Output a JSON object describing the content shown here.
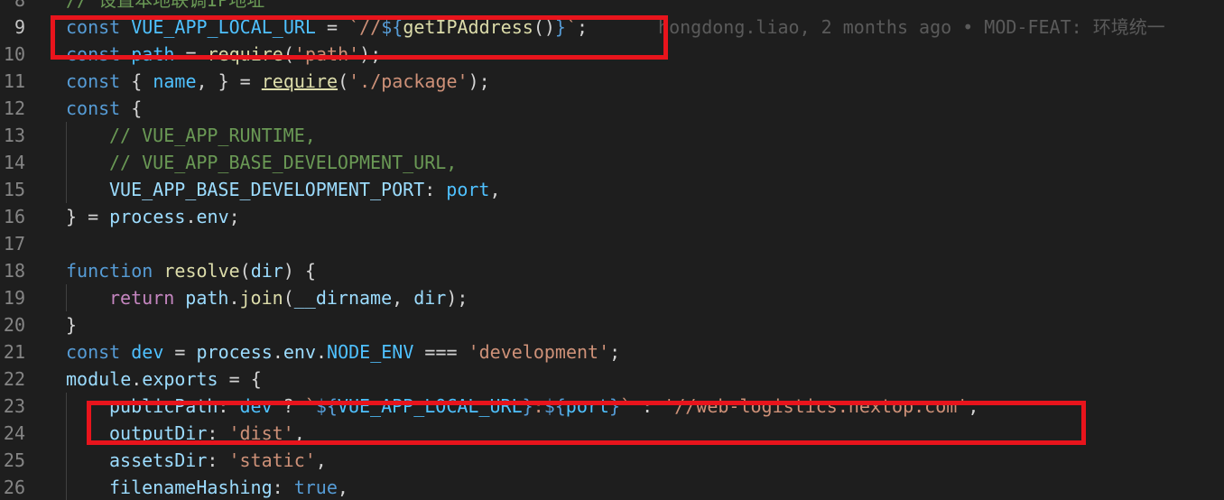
{
  "editor": {
    "accent_box_color": "#e8141c",
    "lines": [
      {
        "num": "8",
        "indent": 0,
        "tokens": [
          [
            "cmt",
            "// 设置本地联调IP地址"
          ]
        ]
      },
      {
        "num": "9",
        "indent": 0,
        "active": true,
        "tokens": [
          [
            "kw",
            "const"
          ],
          [
            "pun",
            " "
          ],
          [
            "cst",
            "VUE_APP_LOCAL_URL"
          ],
          [
            "pun",
            " = "
          ],
          [
            "str",
            "`//"
          ],
          [
            "tpl",
            "${"
          ],
          [
            "fn",
            "getIPAddress"
          ],
          [
            "pun",
            "()"
          ],
          [
            "tpl",
            "}"
          ],
          [
            "str",
            "`"
          ],
          [
            "pun",
            ";"
          ]
        ],
        "blame": "hongdong.liao, 2 months ago • MOD-FEAT: 环境统一"
      },
      {
        "num": "10",
        "indent": 0,
        "tokens": [
          [
            "kw",
            "const"
          ],
          [
            "pun",
            " "
          ],
          [
            "cst",
            "path"
          ],
          [
            "pun",
            " = "
          ],
          [
            "fn",
            "require"
          ],
          [
            "pun",
            "("
          ],
          [
            "str",
            "'path'"
          ],
          [
            "pun",
            ");"
          ]
        ]
      },
      {
        "num": "11",
        "indent": 0,
        "tokens": [
          [
            "kw",
            "const"
          ],
          [
            "pun",
            " { "
          ],
          [
            "cst",
            "name"
          ],
          [
            "pun",
            ", } = "
          ],
          [
            "fn ul",
            "require"
          ],
          [
            "pun",
            "("
          ],
          [
            "str",
            "'./package'"
          ],
          [
            "pun",
            ");"
          ]
        ]
      },
      {
        "num": "12",
        "indent": 0,
        "tokens": [
          [
            "kw",
            "const"
          ],
          [
            "pun",
            " {"
          ]
        ]
      },
      {
        "num": "13",
        "indent": 1,
        "tokens": [
          [
            "cmt",
            "// VUE_APP_RUNTIME,"
          ]
        ]
      },
      {
        "num": "14",
        "indent": 1,
        "tokens": [
          [
            "cmt",
            "// VUE_APP_BASE_DEVELOPMENT_URL,"
          ]
        ]
      },
      {
        "num": "15",
        "indent": 1,
        "tokens": [
          [
            "var",
            "VUE_APP_BASE_DEVELOPMENT_PORT"
          ],
          [
            "pun",
            ": "
          ],
          [
            "cst",
            "port"
          ],
          [
            "pun",
            ","
          ]
        ]
      },
      {
        "num": "16",
        "indent": 0,
        "tokens": [
          [
            "pun",
            "} = "
          ],
          [
            "var",
            "process"
          ],
          [
            "pun",
            "."
          ],
          [
            "var",
            "env"
          ],
          [
            "pun",
            ";"
          ]
        ]
      },
      {
        "num": "17",
        "indent": 0,
        "tokens": []
      },
      {
        "num": "18",
        "indent": 0,
        "tokens": [
          [
            "kw",
            "function"
          ],
          [
            "pun",
            " "
          ],
          [
            "fn",
            "resolve"
          ],
          [
            "pun",
            "("
          ],
          [
            "var",
            "dir"
          ],
          [
            "pun",
            ") {"
          ]
        ]
      },
      {
        "num": "19",
        "indent": 1,
        "tokens": [
          [
            "ctl",
            "return"
          ],
          [
            "pun",
            " "
          ],
          [
            "var",
            "path"
          ],
          [
            "pun",
            "."
          ],
          [
            "fn",
            "join"
          ],
          [
            "pun",
            "("
          ],
          [
            "var",
            "__dirname"
          ],
          [
            "pun",
            ", "
          ],
          [
            "var",
            "dir"
          ],
          [
            "pun",
            ");"
          ]
        ]
      },
      {
        "num": "20",
        "indent": 0,
        "tokens": [
          [
            "pun",
            "}"
          ]
        ]
      },
      {
        "num": "21",
        "indent": 0,
        "tokens": [
          [
            "kw",
            "const"
          ],
          [
            "pun",
            " "
          ],
          [
            "cst",
            "dev"
          ],
          [
            "pun",
            " = "
          ],
          [
            "var",
            "process"
          ],
          [
            "pun",
            "."
          ],
          [
            "var",
            "env"
          ],
          [
            "pun",
            "."
          ],
          [
            "cst",
            "NODE_ENV"
          ],
          [
            "pun",
            " === "
          ],
          [
            "str",
            "'development'"
          ],
          [
            "pun",
            ";"
          ]
        ]
      },
      {
        "num": "22",
        "indent": 0,
        "tokens": [
          [
            "var",
            "module"
          ],
          [
            "pun",
            "."
          ],
          [
            "var",
            "exports"
          ],
          [
            "pun",
            " = {"
          ]
        ]
      },
      {
        "num": "23",
        "indent": 1,
        "tokens": [
          [
            "var",
            "publicPath"
          ],
          [
            "pun",
            ": "
          ],
          [
            "cst",
            "dev"
          ],
          [
            "pun",
            " ? "
          ],
          [
            "str",
            "`"
          ],
          [
            "tpl",
            "${"
          ],
          [
            "cst",
            "VUE_APP_LOCAL_URL"
          ],
          [
            "tpl",
            "}"
          ],
          [
            "str",
            ":"
          ],
          [
            "tpl",
            "${"
          ],
          [
            "cst",
            "port"
          ],
          [
            "tpl",
            "}"
          ],
          [
            "str",
            "`"
          ],
          [
            "pun",
            " : "
          ],
          [
            "str",
            "'//web-logistics.nextop.com'"
          ],
          [
            "pun",
            ","
          ]
        ]
      },
      {
        "num": "24",
        "indent": 1,
        "tokens": [
          [
            "var",
            "outputDir"
          ],
          [
            "pun",
            ": "
          ],
          [
            "str",
            "'dist'"
          ],
          [
            "pun",
            ","
          ]
        ]
      },
      {
        "num": "25",
        "indent": 1,
        "tokens": [
          [
            "var",
            "assetsDir"
          ],
          [
            "pun",
            ": "
          ],
          [
            "str",
            "'static'"
          ],
          [
            "pun",
            ","
          ]
        ]
      },
      {
        "num": "26",
        "indent": 1,
        "tokens": [
          [
            "var",
            "filenameHashing"
          ],
          [
            "pun",
            ": "
          ],
          [
            "kw",
            "true"
          ],
          [
            "pun",
            ","
          ]
        ]
      }
    ]
  }
}
